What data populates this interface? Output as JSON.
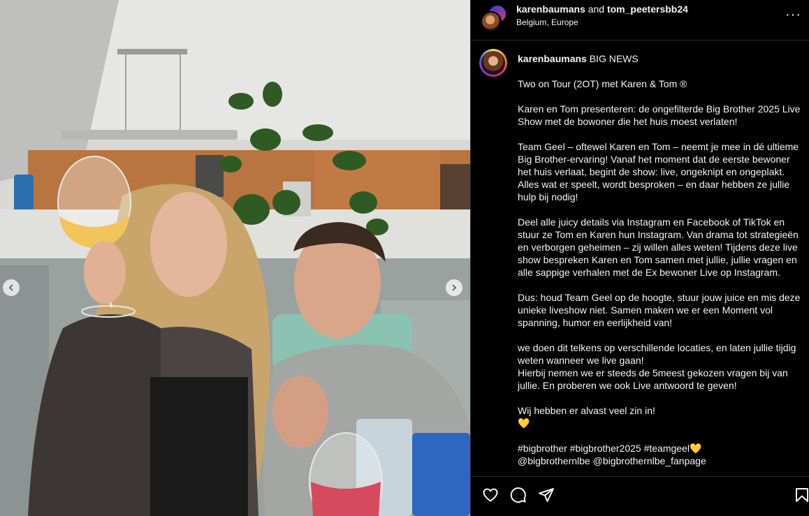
{
  "post": {
    "author": "karenbaumans",
    "coauthor": "tom_peetersbb24",
    "joiner": "and",
    "location": "Belgium, Europe"
  },
  "caption": {
    "username": "karenbaumans",
    "lead": "BIG NEWS",
    "paragraphs": [
      "Two on Tour (2OT) met Karen & Tom ®",
      "Karen en Tom presenteren: de ongefilterde Big Brother 2025 Live Show met de bowoner die het huis moest verlaten!",
      "Team Geel – oftewel Karen en Tom – neemt je mee in dé ultieme Big Brother-ervaring! Vanaf het moment dat de eerste bewoner het huis verlaat, begint de show: live, ongeknipt en ongeplakt. Alles wat er speelt, wordt besproken – en daar hebben ze jullie hulp bij nodig!",
      "Deel alle juicy details via Instagram en Facebook of TikTok en stuur ze Tom en Karen hun Instagram. Van drama tot strategieën en verborgen geheimen – zij willen alles weten! Tijdens deze live show bespreken Karen en Tom samen met jullie, jullie vragen en alle sappige verhalen met de Ex bewoner Live op Instagram.",
      "Dus: houd Team Geel op de hoogte, stuur jouw juice en mis deze unieke liveshow niet. Samen maken we er een Moment vol spanning, humor en eerlijkheid van!",
      "we doen dit telkens op verschillende locaties, en laten jullie tijdig weten wanneer we live gaan!\nHierbij nemen we er steeds de 5meest gekozen vragen bij van jullie. En proberen we ook Live antwoord te geven!",
      "Wij hebben er alvast veel zin in!\n💛",
      "#bigbrother #bigbrother2025 #teamgeel💛\n@bigbrothernlbe @bigbrothernlbe_fanpage"
    ]
  },
  "icons": {
    "like": "heart-icon",
    "comment": "comment-icon",
    "share": "share-icon",
    "save": "bookmark-icon",
    "more": "more-icon",
    "prev": "chevron-left-icon",
    "next": "chevron-right-icon"
  },
  "colors": {
    "background": "#000000",
    "text": "#f5f5f5",
    "divider": "#262626"
  }
}
